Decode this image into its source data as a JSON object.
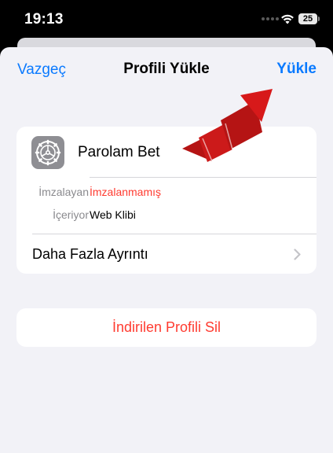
{
  "status_bar": {
    "time": "19:13",
    "battery": "25",
    "wifi_icon": "wifi-icon"
  },
  "nav": {
    "cancel": "Vazgeç",
    "title": "Profili Yükle",
    "install": "Yükle",
    "accent_color": "#0a7aff"
  },
  "profile": {
    "icon": "settings-gear-icon",
    "name": "Parolam Bet",
    "signed_by_label": "İmzalayan",
    "signed_by_value": "İmzalanmamış",
    "signed_by_color": "#ff3b30",
    "contains_label": "İçeriyor",
    "contains_value": "Web Klibi",
    "more_details": "Daha Fazla Ayrıntı"
  },
  "actions": {
    "delete_profile": "İndirilen Profili Sil",
    "delete_color": "#ff3b30"
  },
  "annotation": {
    "arrow_icon": "red-arrow-pointing-to-install",
    "arrow_color": "#d7191a"
  }
}
